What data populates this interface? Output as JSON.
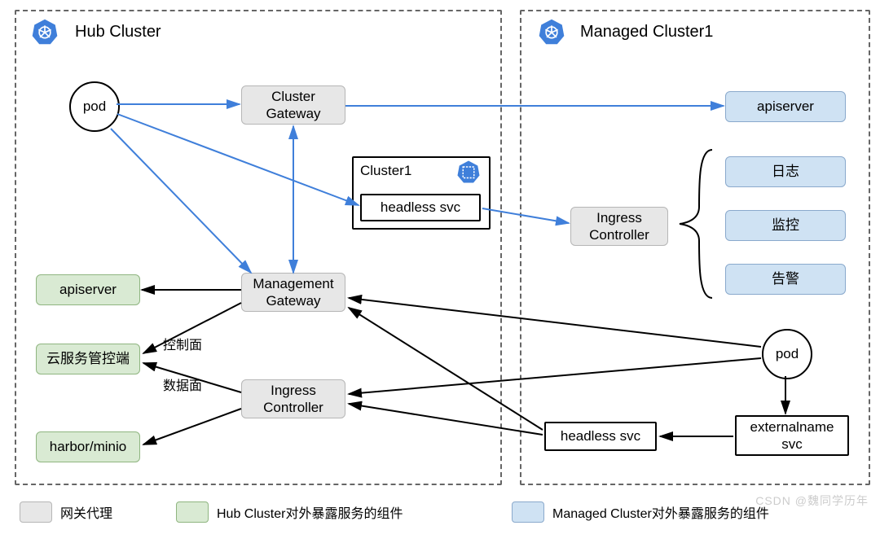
{
  "clusters": {
    "hub": {
      "label": "Hub Cluster"
    },
    "managed": {
      "label": "Managed Cluster1"
    }
  },
  "nodes": {
    "hub_pod": {
      "label": "pod"
    },
    "cluster_gateway": {
      "label": "Cluster\nGateway"
    },
    "mgmt_gateway": {
      "label": "Management\nGateway"
    },
    "ingress_ctrl_hub": {
      "label": "Ingress\nController"
    },
    "apiserver_hub": {
      "label": "apiserver"
    },
    "cloud_admin": {
      "label": "云服务管控端"
    },
    "harbor_minio": {
      "label": "harbor/minio"
    },
    "cluster1_name": {
      "label": "Cluster1"
    },
    "headless_hub": {
      "label": "headless svc"
    },
    "apiserver_mgd": {
      "label": "apiserver"
    },
    "mgd_logs": {
      "label": "日志"
    },
    "mgd_monitor": {
      "label": "监控"
    },
    "mgd_alert": {
      "label": "告警"
    },
    "ingress_ctrl_mgd": {
      "label": "Ingress\nController"
    },
    "mgd_pod": {
      "label": "pod"
    },
    "externalname": {
      "label": "externalname\nsvc"
    },
    "headless_mgd": {
      "label": "headless svc"
    }
  },
  "edge_labels": {
    "ctrl_plane": "控制面",
    "data_plane": "数据面"
  },
  "legend": {
    "gateway_proxy": "网关代理",
    "hub_exposed": "Hub Cluster对外暴露服务的组件",
    "managed_exposed": "Managed Cluster对外暴露服务的组件"
  },
  "edges": [
    {
      "from": "hub_pod",
      "to": "cluster_gateway",
      "color": "blue",
      "style": "arrow"
    },
    {
      "from": "hub_pod",
      "to": "mgmt_gateway",
      "color": "blue",
      "style": "arrow"
    },
    {
      "from": "hub_pod",
      "to": "headless_hub",
      "color": "blue",
      "style": "arrow"
    },
    {
      "from": "mgmt_gateway",
      "to": "cluster_gateway",
      "color": "blue",
      "style": "double-arrow"
    },
    {
      "from": "cluster_gateway",
      "to": "apiserver_mgd",
      "color": "blue",
      "style": "arrow"
    },
    {
      "from": "headless_hub",
      "to": "ingress_ctrl_mgd",
      "color": "blue",
      "style": "arrow"
    },
    {
      "from": "mgmt_gateway",
      "to": "apiserver_hub",
      "color": "black",
      "style": "arrow"
    },
    {
      "from": "mgmt_gateway",
      "to": "cloud_admin",
      "color": "black",
      "style": "arrow",
      "label": "ctrl_plane"
    },
    {
      "from": "ingress_ctrl_hub",
      "to": "cloud_admin",
      "color": "black",
      "style": "arrow",
      "label": "data_plane"
    },
    {
      "from": "ingress_ctrl_hub",
      "to": "harbor_minio",
      "color": "black",
      "style": "arrow"
    },
    {
      "from": "mgd_pod",
      "to": "mgmt_gateway",
      "color": "black",
      "style": "arrow"
    },
    {
      "from": "mgd_pod",
      "to": "ingress_ctrl_hub",
      "color": "black",
      "style": "arrow"
    },
    {
      "from": "mgd_pod",
      "to": "externalname",
      "color": "black",
      "style": "arrow"
    },
    {
      "from": "externalname",
      "to": "headless_mgd",
      "color": "black",
      "style": "arrow"
    },
    {
      "from": "headless_mgd",
      "to": "mgmt_gateway",
      "color": "black",
      "style": "arrow"
    },
    {
      "from": "headless_mgd",
      "to": "ingress_ctrl_hub",
      "color": "black",
      "style": "arrow"
    }
  ],
  "watermark": "CSDN @魏同学历年"
}
